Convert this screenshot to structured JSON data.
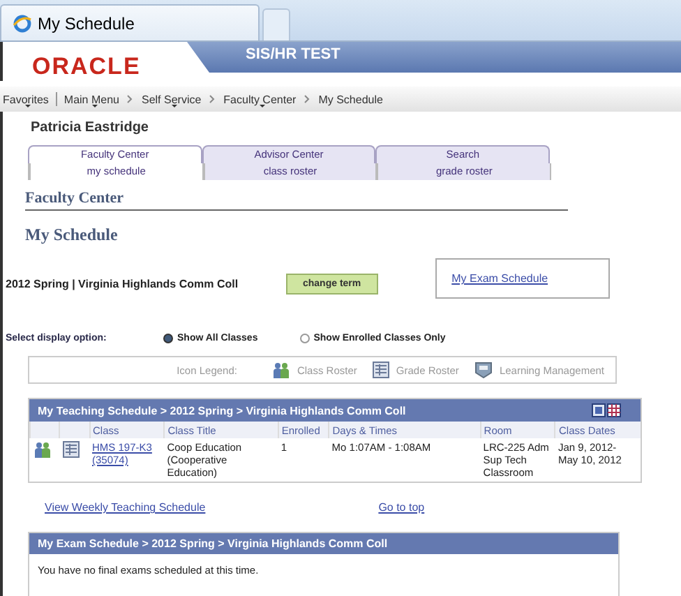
{
  "browser_tab": {
    "title": "My Schedule"
  },
  "header": {
    "logo": "ORACLE",
    "environment": "SIS/HR TEST"
  },
  "breadcrumbs": [
    {
      "label": "Favorites",
      "dropdown": true
    },
    {
      "label": "Main Menu",
      "dropdown": true
    },
    {
      "label": "Self Service",
      "dropdown": true
    },
    {
      "label": "Faculty Center",
      "dropdown": true
    },
    {
      "label": "My Schedule",
      "dropdown": false
    }
  ],
  "user_name": "Patricia Eastridge",
  "tabs": [
    {
      "label": "Faculty Center",
      "selected": true
    },
    {
      "label": "Advisor Center",
      "selected": false
    },
    {
      "label": "Search",
      "selected": false
    }
  ],
  "sub_tabs": [
    {
      "label": "my schedule",
      "selected": true
    },
    {
      "label": "class roster",
      "selected": false
    },
    {
      "label": "grade roster",
      "selected": false
    }
  ],
  "section_title": "Faculty Center",
  "page_title": "My Schedule",
  "term": {
    "label": "2012 Spring | Virginia Highlands Comm Coll",
    "button": "change term"
  },
  "exam_link": "My Exam Schedule",
  "display_option": {
    "label": "Select display option:",
    "options": [
      {
        "label": "Show All Classes",
        "selected": true
      },
      {
        "label": "Show Enrolled Classes Only",
        "selected": false
      }
    ]
  },
  "legend": {
    "label": "Icon Legend:",
    "items": [
      {
        "label": "Class Roster",
        "kind": "roster"
      },
      {
        "label": "Grade Roster",
        "kind": "grade"
      },
      {
        "label": "Learning Management",
        "kind": "learning"
      }
    ]
  },
  "teaching_schedule": {
    "title": "My Teaching Schedule > 2012 Spring > Virginia Highlands Comm Coll",
    "columns": [
      "Class",
      "Class Title",
      "Enrolled",
      "Days & Times",
      "Room",
      "Class Dates"
    ],
    "rows": [
      {
        "class": "HMS 197-K3 (35074)",
        "title": "Coop Education (Cooperative Education)",
        "enrolled": "1",
        "days_times": "Mo 1:07AM - 1:08AM",
        "room": "LRC-225 Adm Sup Tech Classroom",
        "dates": "Jan 9, 2012- May 10, 2012"
      }
    ]
  },
  "links": {
    "weekly": "View Weekly Teaching Schedule",
    "top": "Go to top"
  },
  "exam_schedule": {
    "title": "My Exam Schedule > 2012 Spring > Virginia Highlands Comm Coll",
    "message": "You have no final exams scheduled at this time."
  }
}
